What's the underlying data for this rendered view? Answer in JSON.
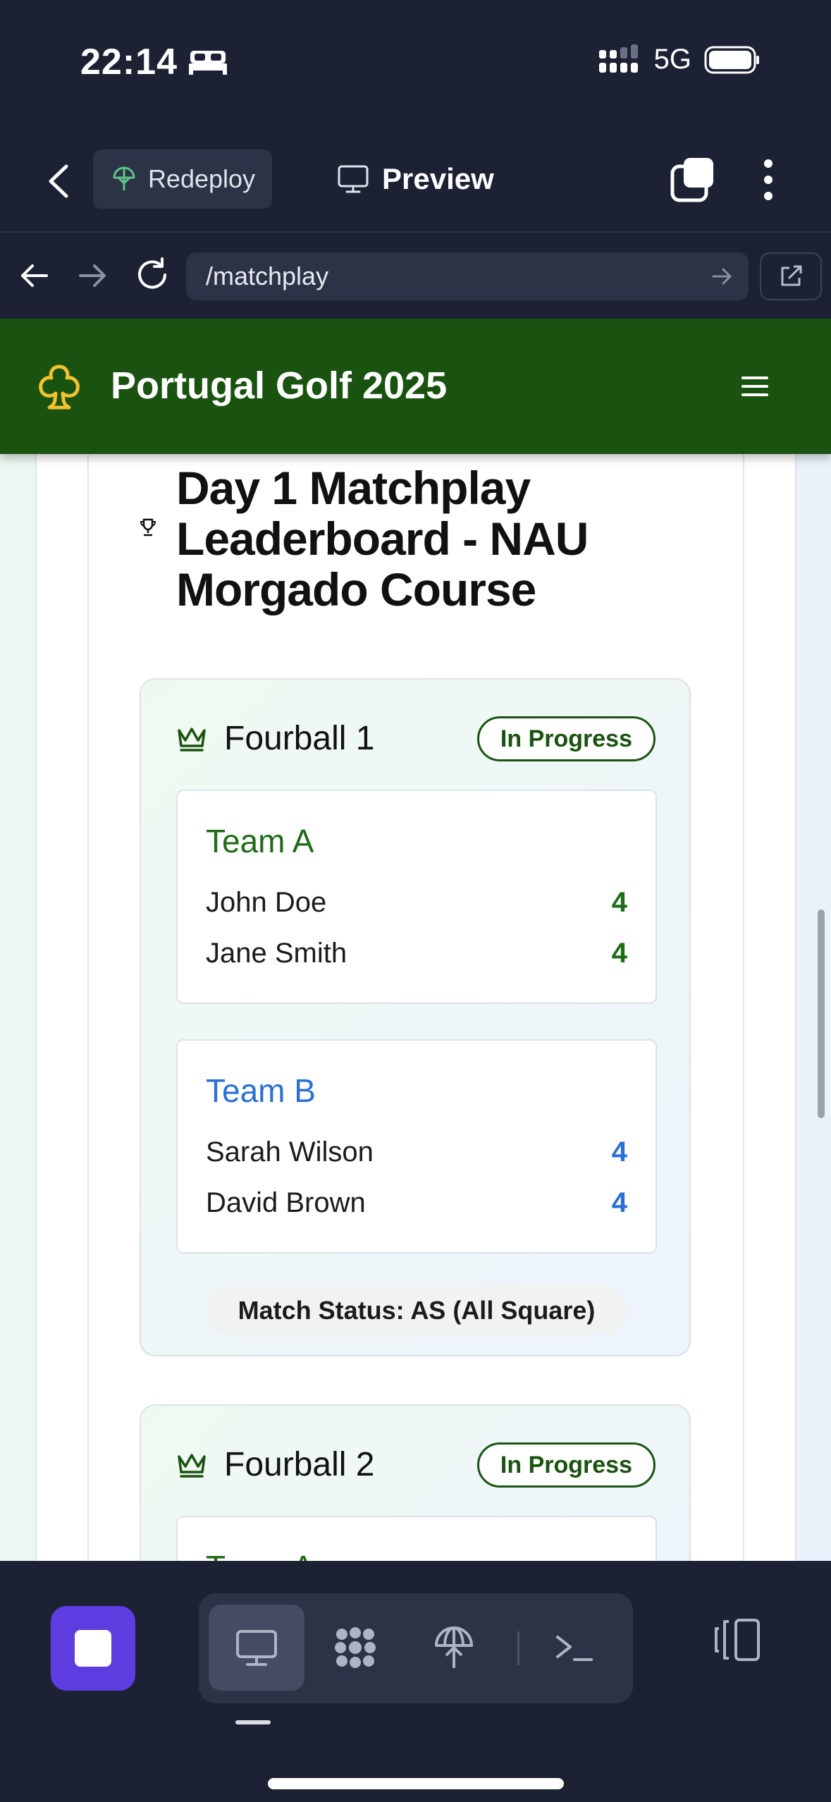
{
  "status_bar": {
    "time": "22:14",
    "network": "5G",
    "icons": [
      "bed-icon",
      "signal-icon",
      "battery-icon"
    ]
  },
  "toolbar": {
    "back_icon": "chevron-left-icon",
    "redeploy_label": "Redeploy",
    "preview_label": "Preview",
    "tabs_icon": "tabs-icon",
    "more_icon": "more-vertical-icon"
  },
  "url_bar": {
    "url": "/matchplay",
    "icons": [
      "arrow-left-icon",
      "arrow-right-icon",
      "reload-icon",
      "arrow-right-icon",
      "open-external-icon"
    ]
  },
  "app": {
    "title": "Portugal Golf 2025",
    "logo_icon": "club-icon",
    "menu_icon": "hamburger-menu-icon",
    "brand_color": "#1a5310"
  },
  "leaderboard": {
    "title": "Day 1 Matchplay Leaderboard - NAU Morgado Course",
    "fourballs": [
      {
        "name": "Fourball 1",
        "status": "In Progress",
        "teams": [
          {
            "name": "Team A",
            "color": "#1f6b17",
            "players": [
              {
                "name": "John Doe",
                "score": "4"
              },
              {
                "name": "Jane Smith",
                "score": "4"
              }
            ]
          },
          {
            "name": "Team B",
            "color": "#2a6fd6",
            "players": [
              {
                "name": "Sarah Wilson",
                "score": "4"
              },
              {
                "name": "David Brown",
                "score": "4"
              }
            ]
          }
        ],
        "match_status": "Match Status: AS (All Square)"
      },
      {
        "name": "Fourball 2",
        "status": "In Progress",
        "teams": [
          {
            "name": "Team A",
            "color": "#1f6b17"
          }
        ]
      }
    ]
  },
  "bottom_bar": {
    "stop_icon": "stop-icon",
    "segments": [
      "desktop-icon",
      "ai-agent-icon",
      "deploy-icon",
      "terminal-icon"
    ],
    "active_segment": "desktop-icon",
    "layout_icon": "layout-toggle-icon",
    "accent_color": "#5d3ce0"
  }
}
